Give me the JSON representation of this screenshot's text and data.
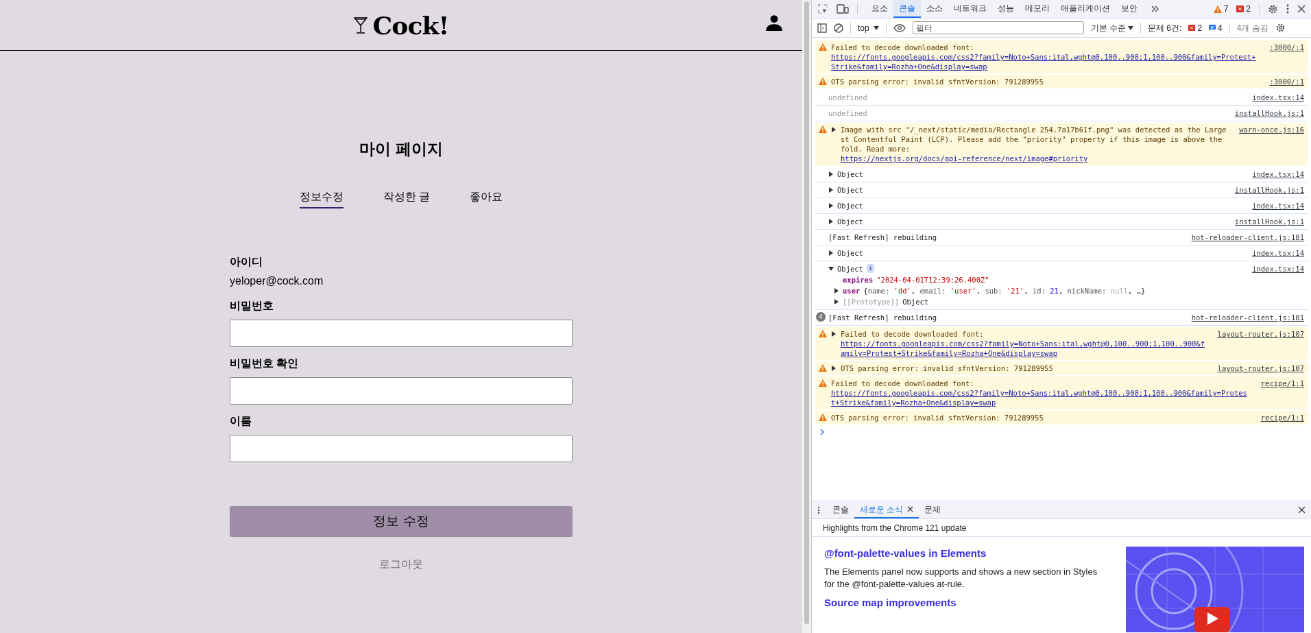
{
  "header": {
    "logo": "Cock!"
  },
  "page": {
    "title": "마이 페이지",
    "tabs": [
      {
        "label": "정보수정",
        "selected": true
      },
      {
        "label": "작성한 글",
        "selected": false
      },
      {
        "label": "좋아요",
        "selected": false
      }
    ],
    "id_label": "아이디",
    "id_value": "yeloper@cock.com",
    "fields": [
      {
        "label": "비밀번호"
      },
      {
        "label": "비밀번호 확인"
      },
      {
        "label": "이름"
      }
    ],
    "submit": "정보 수정",
    "logout": "로그아웃"
  },
  "devtools": {
    "tabs": [
      {
        "label": "요소",
        "selected": false
      },
      {
        "label": "콘솔",
        "selected": true
      },
      {
        "label": "소스",
        "selected": false
      },
      {
        "label": "네트워크",
        "selected": false
      },
      {
        "label": "성능",
        "selected": false
      },
      {
        "label": "메모리",
        "selected": false
      },
      {
        "label": "애플리케이션",
        "selected": false
      },
      {
        "label": "보안",
        "selected": false
      }
    ],
    "warning_count": "7",
    "error_count": "2",
    "toolbar": {
      "context": "top",
      "filter_placeholder": "필터",
      "level": "기본 수준",
      "issues_label": "문제 6건:",
      "issue_errors": "2",
      "issue_infos": "4",
      "hidden": "4개 숨김"
    },
    "messages": [
      {
        "kind": "warning",
        "text": "Failed to decode downloaded font: ",
        "link": "https://fonts.googleapis.com/css2?family=Noto+Sans:ital,wght@0,100..900;1,100..900&family=Protest+Strike&family=Rozha+One&display=swap",
        "source": ":3000/:1"
      },
      {
        "kind": "warning",
        "text": "OTS parsing error: invalid sfntVersion: 791289955",
        "source": ":3000/:1"
      },
      {
        "kind": "muted",
        "text": "undefined",
        "source": "index.tsx:14"
      },
      {
        "kind": "muted",
        "text": "undefined",
        "source": "installHook.js:1"
      },
      {
        "kind": "warning",
        "expanded": false,
        "text": "Image with src \"/_next/static/media/Rectangle 254.7a17b61f.png\" was detected as the Largest Contentful Paint (LCP). Please add the \"priority\" property if this image is above the fold. Read more: ",
        "link": "https://nextjs.org/docs/api-reference/next/image#priority",
        "source": "warn-once.js:16"
      },
      {
        "kind": "object",
        "expanded": false,
        "text": "Object",
        "source": "index.tsx:14"
      },
      {
        "kind": "object",
        "expanded": false,
        "text": "Object",
        "source": "installHook.js:1"
      },
      {
        "kind": "object",
        "expanded": false,
        "text": "Object",
        "source": "index.tsx:14"
      },
      {
        "kind": "object",
        "expanded": false,
        "text": "Object",
        "source": "installHook.js:1"
      },
      {
        "kind": "log",
        "text": "[Fast Refresh] rebuilding",
        "source": "hot-reloader-client.js:181"
      },
      {
        "kind": "object",
        "expanded": false,
        "text": "Object",
        "source": "index.tsx:14"
      },
      {
        "kind": "object",
        "expanded": true,
        "text": "Object",
        "badge": "i",
        "source": "index.tsx:14",
        "properties": [
          {
            "kind": "string",
            "key": "expires",
            "value": "\"2024-04-01T12:39:26.400Z\""
          },
          {
            "kind": "object",
            "key": "user",
            "expanded": false,
            "segments": [
              {
                "kind": "plain",
                "text": "{"
              },
              {
                "kind": "key",
                "text": "name: "
              },
              {
                "kind": "string",
                "text": "'dd'"
              },
              {
                "kind": "plain",
                "text": ", "
              },
              {
                "kind": "key",
                "text": "email: "
              },
              {
                "kind": "string",
                "text": "'user'"
              },
              {
                "kind": "plain",
                "text": ", "
              },
              {
                "kind": "key",
                "text": "sub: "
              },
              {
                "kind": "string",
                "text": "'21'"
              },
              {
                "kind": "plain",
                "text": ", "
              },
              {
                "kind": "key",
                "text": "id: "
              },
              {
                "kind": "number",
                "text": "21"
              },
              {
                "kind": "plain",
                "text": ", "
              },
              {
                "kind": "key",
                "text": "nickName: "
              },
              {
                "kind": "null",
                "text": "null"
              },
              {
                "kind": "plain",
                "text": ", …}"
              }
            ]
          },
          {
            "kind": "internal",
            "key": "[[Prototype]]",
            "expanded": false,
            "value": "Object"
          }
        ]
      },
      {
        "kind": "log",
        "count": "4",
        "text": "[Fast Refresh] rebuilding",
        "source": "hot-reloader-client.js:181"
      },
      {
        "kind": "warning",
        "expanded": false,
        "text": "Failed to decode downloaded font: ",
        "link": "https://fonts.googleapis.com/css2?family=Noto+Sans:ital,wght@0,100..900;1,100..900&family=Protest+Strike&family=Rozha+One&display=swap",
        "source": "layout-router.js:107"
      },
      {
        "kind": "warning",
        "expanded": false,
        "text": "OTS parsing error: invalid sfntVersion: 791289955",
        "source": "layout-router.js:107"
      },
      {
        "kind": "warning",
        "text": "Failed to decode downloaded font: ",
        "link": "https://fonts.googleapis.com/css2?family=Noto+Sans:ital,wght@0,100..900;1,100..900&family=Protest+Strike&family=Rozha+One&display=swap",
        "source": "recipe/1:1"
      },
      {
        "kind": "warning",
        "text": "OTS parsing error: invalid sfntVersion: 791289955",
        "source": "recipe/1:1"
      }
    ],
    "drawer": {
      "tabs": [
        {
          "label": "콘솔",
          "selected": false,
          "closable": false
        },
        {
          "label": "새로운 소식",
          "selected": true,
          "closable": true
        },
        {
          "label": "문제",
          "selected": false,
          "closable": false
        }
      ],
      "heading": "Highlights from the Chrome 121 update",
      "articles": [
        {
          "title": "@font-palette-values in Elements",
          "body": "The Elements panel now supports and shows a new section in Styles for the @font-palette-values at-rule."
        },
        {
          "title": "Source map improvements"
        }
      ]
    }
  }
}
